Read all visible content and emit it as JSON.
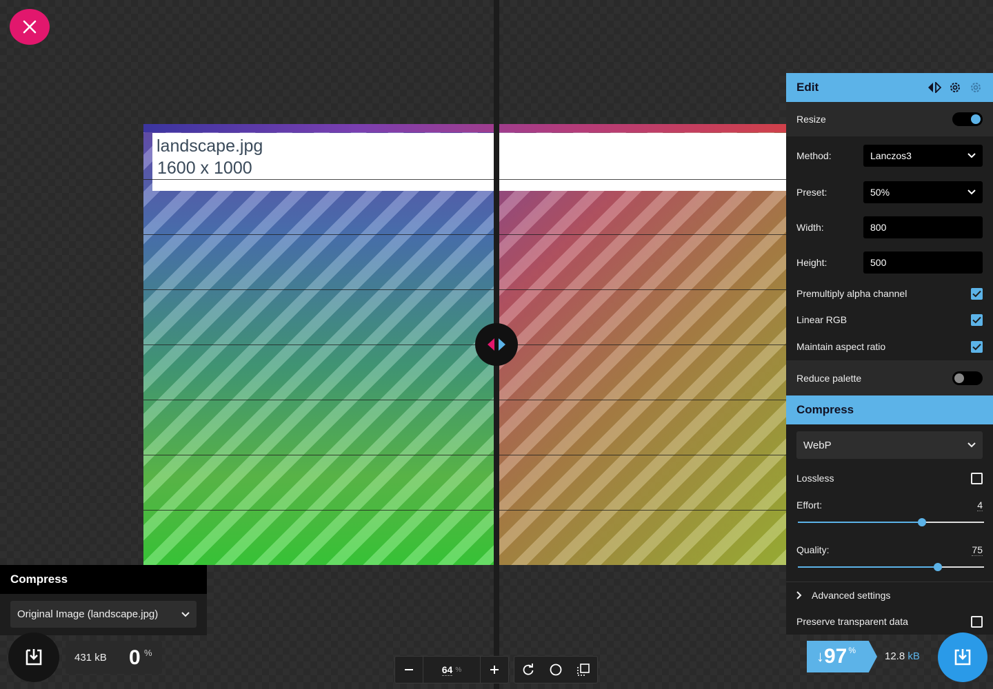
{
  "image": {
    "filename_label": "landscape.jpg",
    "dimensions_label": "1600 x 1000"
  },
  "toolbar": {
    "zoom_value": "64",
    "zoom_unit": "%"
  },
  "left_panel": {
    "title": "Compress",
    "source_select": "Original Image (landscape.jpg)",
    "size": "431 kB",
    "percent": "0",
    "percent_sign": "%"
  },
  "edit_panel": {
    "title": "Edit",
    "resize": {
      "label": "Resize",
      "enabled": true
    },
    "method": {
      "label": "Method:",
      "value": "Lanczos3"
    },
    "preset": {
      "label": "Preset:",
      "value": "50%"
    },
    "width": {
      "label": "Width:",
      "value": "800"
    },
    "height": {
      "label": "Height:",
      "value": "500"
    },
    "premultiply": {
      "label": "Premultiply alpha channel",
      "checked": true
    },
    "linear_rgb": {
      "label": "Linear RGB",
      "checked": true
    },
    "maintain_aspect": {
      "label": "Maintain aspect ratio",
      "checked": true
    },
    "reduce_palette": {
      "label": "Reduce palette",
      "enabled": false
    }
  },
  "compress_panel": {
    "title": "Compress",
    "format": "WebP",
    "lossless": {
      "label": "Lossless",
      "checked": false
    },
    "effort": {
      "label": "Effort:",
      "value": "4",
      "fraction": 0.667
    },
    "quality": {
      "label": "Quality:",
      "value": "75",
      "fraction": 0.75
    },
    "advanced": "Advanced settings",
    "preserve_transparent": {
      "label": "Preserve transparent data",
      "checked": false
    }
  },
  "result": {
    "arrow": "↓",
    "percent": "97",
    "percent_sign": "%",
    "size_value": "12.8",
    "size_unit": "kB"
  },
  "colors": {
    "accent": "#5cb3e8",
    "close": "#e2176d",
    "divider_left_arrow": "#e2176d",
    "divider_right_arrow": "#5cb3e8"
  }
}
